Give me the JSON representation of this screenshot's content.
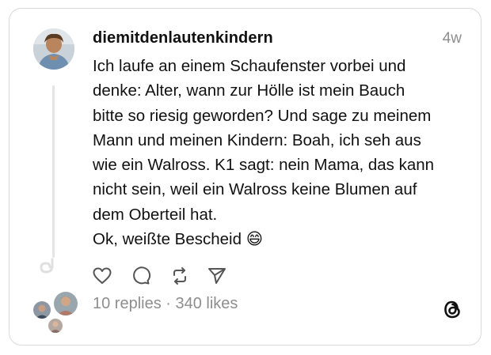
{
  "post": {
    "username": "diemitdenlautenkindern",
    "time": "4w",
    "lines": [
      "Ich laufe an einem Schaufenster vorbei und",
      "denke: Alter, wann zur Hölle ist mein Bauch",
      "bitte so riesig geworden? Und sage zu meinem",
      "Mann und meinen Kindern: Boah, ich seh aus",
      "wie ein Walross. K1 sagt: nein Mama, das kann",
      "nicht sein, weil ein Walross keine Blumen auf",
      "dem Oberteil hat.",
      "Ok, weißte Bescheid 😄"
    ],
    "stats": "10 replies · 340 likes"
  },
  "icons": {
    "like": "heart-icon",
    "reply": "comment-icon",
    "repost": "repost-icon",
    "share": "send-icon",
    "brand": "threads-logo-icon"
  },
  "colors": {
    "text": "#111111",
    "muted": "#8e8e8e",
    "border": "#d9d9d9",
    "line": "#e4e4e4"
  }
}
